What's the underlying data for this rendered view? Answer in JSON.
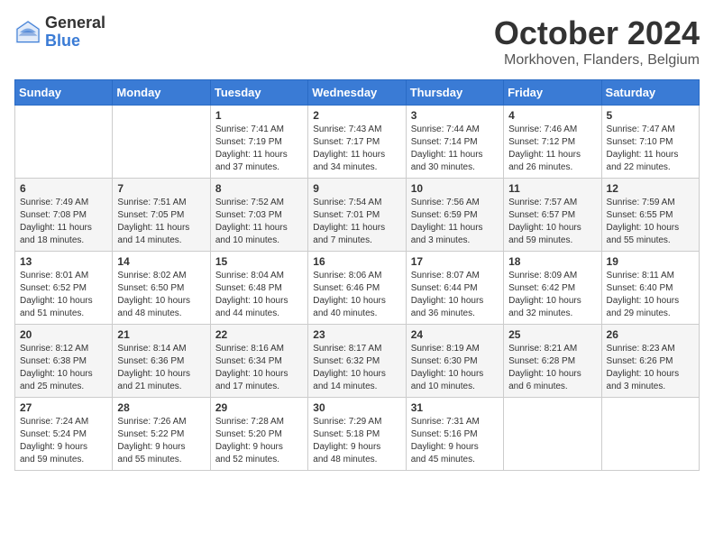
{
  "header": {
    "logo_general": "General",
    "logo_blue": "Blue",
    "main_title": "October 2024",
    "subtitle": "Morkhoven, Flanders, Belgium"
  },
  "calendar": {
    "days_of_week": [
      "Sunday",
      "Monday",
      "Tuesday",
      "Wednesday",
      "Thursday",
      "Friday",
      "Saturday"
    ],
    "weeks": [
      [
        {
          "day": "",
          "info": ""
        },
        {
          "day": "",
          "info": ""
        },
        {
          "day": "1",
          "info": "Sunrise: 7:41 AM\nSunset: 7:19 PM\nDaylight: 11 hours\nand 37 minutes."
        },
        {
          "day": "2",
          "info": "Sunrise: 7:43 AM\nSunset: 7:17 PM\nDaylight: 11 hours\nand 34 minutes."
        },
        {
          "day": "3",
          "info": "Sunrise: 7:44 AM\nSunset: 7:14 PM\nDaylight: 11 hours\nand 30 minutes."
        },
        {
          "day": "4",
          "info": "Sunrise: 7:46 AM\nSunset: 7:12 PM\nDaylight: 11 hours\nand 26 minutes."
        },
        {
          "day": "5",
          "info": "Sunrise: 7:47 AM\nSunset: 7:10 PM\nDaylight: 11 hours\nand 22 minutes."
        }
      ],
      [
        {
          "day": "6",
          "info": "Sunrise: 7:49 AM\nSunset: 7:08 PM\nDaylight: 11 hours\nand 18 minutes."
        },
        {
          "day": "7",
          "info": "Sunrise: 7:51 AM\nSunset: 7:05 PM\nDaylight: 11 hours\nand 14 minutes."
        },
        {
          "day": "8",
          "info": "Sunrise: 7:52 AM\nSunset: 7:03 PM\nDaylight: 11 hours\nand 10 minutes."
        },
        {
          "day": "9",
          "info": "Sunrise: 7:54 AM\nSunset: 7:01 PM\nDaylight: 11 hours\nand 7 minutes."
        },
        {
          "day": "10",
          "info": "Sunrise: 7:56 AM\nSunset: 6:59 PM\nDaylight: 11 hours\nand 3 minutes."
        },
        {
          "day": "11",
          "info": "Sunrise: 7:57 AM\nSunset: 6:57 PM\nDaylight: 10 hours\nand 59 minutes."
        },
        {
          "day": "12",
          "info": "Sunrise: 7:59 AM\nSunset: 6:55 PM\nDaylight: 10 hours\nand 55 minutes."
        }
      ],
      [
        {
          "day": "13",
          "info": "Sunrise: 8:01 AM\nSunset: 6:52 PM\nDaylight: 10 hours\nand 51 minutes."
        },
        {
          "day": "14",
          "info": "Sunrise: 8:02 AM\nSunset: 6:50 PM\nDaylight: 10 hours\nand 48 minutes."
        },
        {
          "day": "15",
          "info": "Sunrise: 8:04 AM\nSunset: 6:48 PM\nDaylight: 10 hours\nand 44 minutes."
        },
        {
          "day": "16",
          "info": "Sunrise: 8:06 AM\nSunset: 6:46 PM\nDaylight: 10 hours\nand 40 minutes."
        },
        {
          "day": "17",
          "info": "Sunrise: 8:07 AM\nSunset: 6:44 PM\nDaylight: 10 hours\nand 36 minutes."
        },
        {
          "day": "18",
          "info": "Sunrise: 8:09 AM\nSunset: 6:42 PM\nDaylight: 10 hours\nand 32 minutes."
        },
        {
          "day": "19",
          "info": "Sunrise: 8:11 AM\nSunset: 6:40 PM\nDaylight: 10 hours\nand 29 minutes."
        }
      ],
      [
        {
          "day": "20",
          "info": "Sunrise: 8:12 AM\nSunset: 6:38 PM\nDaylight: 10 hours\nand 25 minutes."
        },
        {
          "day": "21",
          "info": "Sunrise: 8:14 AM\nSunset: 6:36 PM\nDaylight: 10 hours\nand 21 minutes."
        },
        {
          "day": "22",
          "info": "Sunrise: 8:16 AM\nSunset: 6:34 PM\nDaylight: 10 hours\nand 17 minutes."
        },
        {
          "day": "23",
          "info": "Sunrise: 8:17 AM\nSunset: 6:32 PM\nDaylight: 10 hours\nand 14 minutes."
        },
        {
          "day": "24",
          "info": "Sunrise: 8:19 AM\nSunset: 6:30 PM\nDaylight: 10 hours\nand 10 minutes."
        },
        {
          "day": "25",
          "info": "Sunrise: 8:21 AM\nSunset: 6:28 PM\nDaylight: 10 hours\nand 6 minutes."
        },
        {
          "day": "26",
          "info": "Sunrise: 8:23 AM\nSunset: 6:26 PM\nDaylight: 10 hours\nand 3 minutes."
        }
      ],
      [
        {
          "day": "27",
          "info": "Sunrise: 7:24 AM\nSunset: 5:24 PM\nDaylight: 9 hours\nand 59 minutes."
        },
        {
          "day": "28",
          "info": "Sunrise: 7:26 AM\nSunset: 5:22 PM\nDaylight: 9 hours\nand 55 minutes."
        },
        {
          "day": "29",
          "info": "Sunrise: 7:28 AM\nSunset: 5:20 PM\nDaylight: 9 hours\nand 52 minutes."
        },
        {
          "day": "30",
          "info": "Sunrise: 7:29 AM\nSunset: 5:18 PM\nDaylight: 9 hours\nand 48 minutes."
        },
        {
          "day": "31",
          "info": "Sunrise: 7:31 AM\nSunset: 5:16 PM\nDaylight: 9 hours\nand 45 minutes."
        },
        {
          "day": "",
          "info": ""
        },
        {
          "day": "",
          "info": ""
        }
      ]
    ]
  }
}
